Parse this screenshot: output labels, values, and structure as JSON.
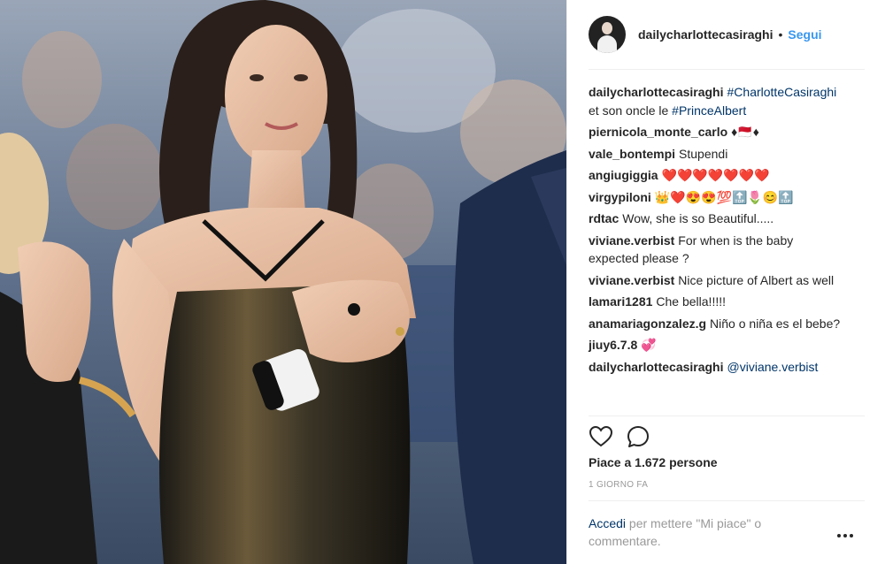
{
  "post": {
    "username": "dailycharlottecasiraghi",
    "dot": "•",
    "follow_label": "Segui"
  },
  "comments": [
    {
      "user": "dailycharlottecasiraghi",
      "parts": [
        {
          "t": "#CharlotteCasiraghi",
          "tag": true
        },
        {
          "t": " et son oncle le "
        },
        {
          "t": "#PrinceAlbert",
          "tag": true
        }
      ]
    },
    {
      "user": "piernicola_monte_carlo",
      "parts": [
        {
          "t": "♦🇲🇨♦"
        }
      ]
    },
    {
      "user": "vale_bontempi",
      "parts": [
        {
          "t": "Stupendi"
        }
      ]
    },
    {
      "user": "angiugiggia",
      "parts": [
        {
          "t": "❤️❤️❤️❤️❤️❤️❤️"
        }
      ]
    },
    {
      "user": "virgypiloni",
      "parts": [
        {
          "t": "👑❤️😍😍💯🔝🌷😊🔝"
        }
      ]
    },
    {
      "user": "rdtac",
      "parts": [
        {
          "t": "Wow, she is so Beautiful....."
        }
      ]
    },
    {
      "user": "viviane.verbist",
      "parts": [
        {
          "t": "For when is the baby expected please ?"
        }
      ]
    },
    {
      "user": "viviane.verbist",
      "parts": [
        {
          "t": "Nice picture of Albert as well"
        }
      ]
    },
    {
      "user": "lamari1281",
      "parts": [
        {
          "t": "Che bella!!!!!"
        }
      ]
    },
    {
      "user": "anamariagonzalez.g",
      "parts": [
        {
          "t": "Niño o niña es el bebe?"
        }
      ]
    },
    {
      "user": "jiuy6.7.8",
      "parts": [
        {
          "t": "💞"
        }
      ]
    },
    {
      "user": "dailycharlottecasiraghi",
      "parts": [
        {
          "t": "@viviane.verbist",
          "tag": true
        }
      ]
    }
  ],
  "likes": "Piace a 1.672 persone",
  "time_ago": "1 GIORNO FA",
  "login_prompt": {
    "link": "Accedi",
    "rest": " per mettere \"Mi piace\" o commentare."
  },
  "icons": {
    "like": "heart-outline-icon",
    "comment": "comment-bubble-icon",
    "more": "more-options-icon"
  },
  "colors": {
    "link_blue": "#3897f0",
    "tag_dark_blue": "#003569",
    "muted": "#999999",
    "text": "#262626"
  }
}
